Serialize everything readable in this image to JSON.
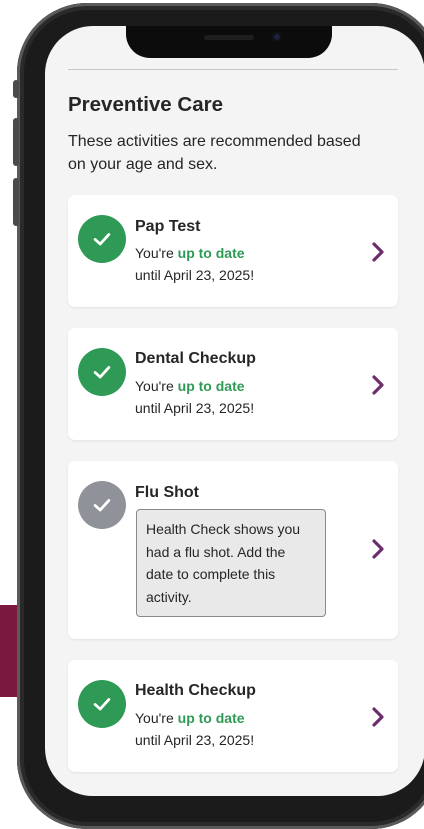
{
  "header": {
    "title": "Preventive Care",
    "subtitle": "These activities are recommended based on your age and sex."
  },
  "activities": [
    {
      "name": "Pap Test",
      "state": "up_to_date",
      "prefix": "You're ",
      "highlight": "up to date",
      "until": "until April 23, 2025!"
    },
    {
      "name": "Dental Checkup",
      "state": "up_to_date",
      "prefix": "You're ",
      "highlight": "up to date",
      "until": "until April 23, 2025!"
    },
    {
      "name": "Flu Shot",
      "state": "pending",
      "note": "Health Check shows you had a flu shot. Add the date to complete this activity."
    },
    {
      "name": "Health Checkup",
      "state": "up_to_date",
      "prefix": "You're ",
      "highlight": "up to date",
      "until": "until April 23, 2025!"
    }
  ],
  "icons": {
    "status_done": "check-circle-icon",
    "status_pending": "check-circle-icon",
    "row_action": "chevron-right-icon"
  },
  "colors": {
    "done": "#2f9a56",
    "pending": "#8f9298",
    "chevron": "#6b2d6b",
    "brand_accent": "#7a1840"
  }
}
